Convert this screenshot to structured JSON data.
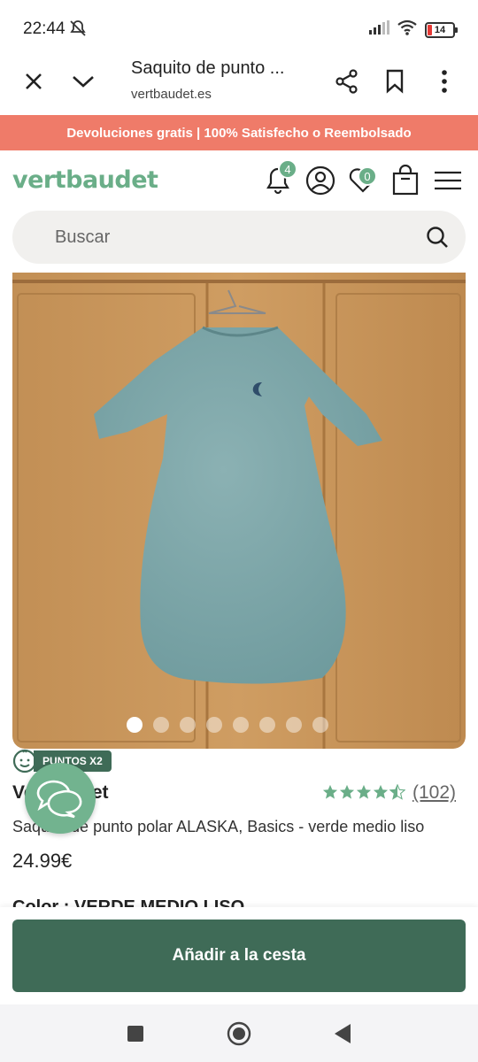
{
  "status": {
    "time": "22:44",
    "battery": "14",
    "icons": [
      "bell-off-icon",
      "signal-icon",
      "wifi-icon",
      "battery-icon"
    ]
  },
  "browser": {
    "title": "Saquito de punto ...",
    "url": "vertbaudet.es",
    "icons": [
      "close-icon",
      "chevron-down-icon",
      "share-icon",
      "bookmark-icon",
      "more-icon"
    ]
  },
  "promo": {
    "text": "Devoluciones gratis | 100% Satisfecho o Reembolsado"
  },
  "header": {
    "logo": "vertbaudet",
    "notifications_count": "4",
    "wishlist_count": "0"
  },
  "search": {
    "placeholder": "Buscar"
  },
  "gallery": {
    "image_count": 8,
    "active_index": 0
  },
  "product": {
    "points_label": "PUNTOS X2",
    "brand": "Vertbaudet",
    "rating": 4.5,
    "reviews": "(102)",
    "name": "Saquito de punto polar ALASKA, Basics - verde medio liso",
    "price": "24.99€",
    "color_label": "Color : VERDE MEDIO LISO"
  },
  "cart": {
    "button_label": "Añadir a la cesta"
  },
  "colors": {
    "brand_green": "#6aae88",
    "dark_green": "#3f6b57",
    "promo_bg": "#ef7b69"
  }
}
